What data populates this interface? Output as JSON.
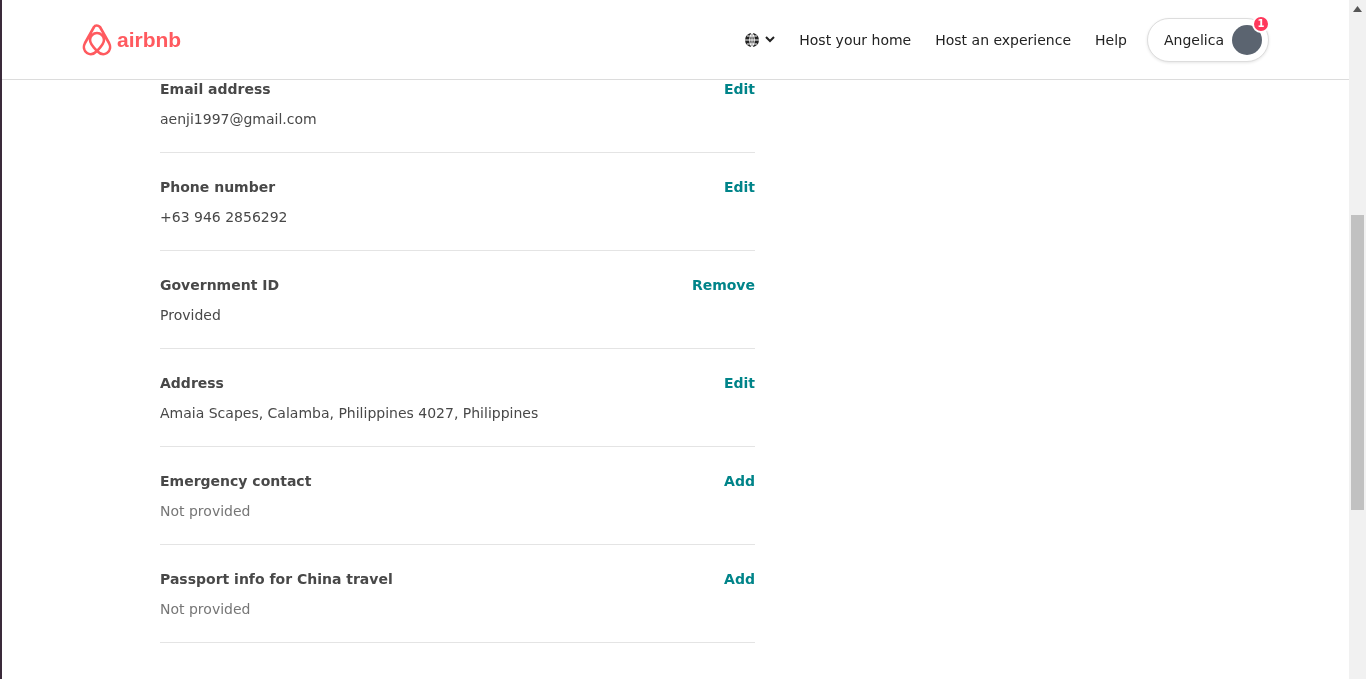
{
  "header": {
    "logo": "airbnb",
    "nav": [
      "Host your home",
      "Host an experience",
      "Help"
    ],
    "user": {
      "name": "Angelica",
      "badge": "1"
    }
  },
  "fields": [
    {
      "label": "Email address",
      "value": "aenji1997@gmail.com",
      "action": "Edit",
      "provided": true
    },
    {
      "label": "Phone number",
      "value": "+63 946 2856292",
      "action": "Edit",
      "provided": true
    },
    {
      "label": "Government ID",
      "value": "Provided",
      "action": "Remove",
      "provided": true
    },
    {
      "label": "Address",
      "value": "Amaia Scapes, Calamba, Philippines 4027, Philippines",
      "action": "Edit",
      "provided": true
    },
    {
      "label": "Emergency contact",
      "value": "Not provided",
      "action": "Add",
      "provided": false
    },
    {
      "label": "Passport info for China travel",
      "value": "Not provided",
      "action": "Add",
      "provided": false
    }
  ]
}
